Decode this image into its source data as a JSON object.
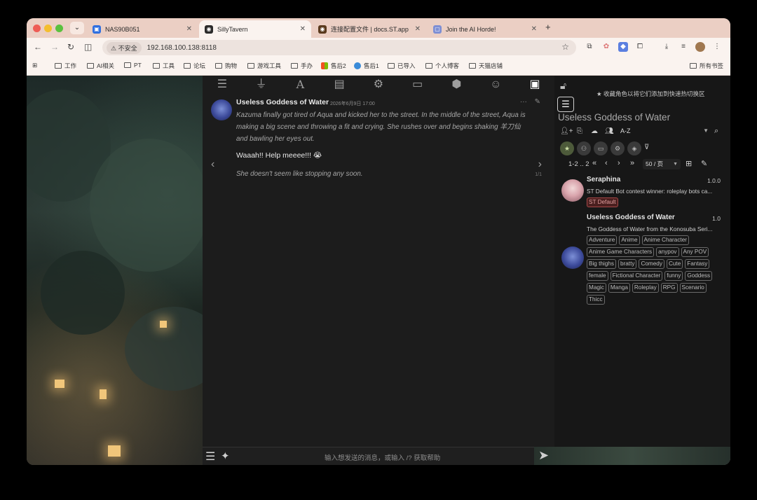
{
  "browser": {
    "tabs": [
      {
        "title": "NAS90B051",
        "active": false
      },
      {
        "title": "SillyTavern",
        "active": true
      },
      {
        "title": "连接配置文件 | docs.ST.app",
        "active": false
      },
      {
        "title": "Join the AI Horde!",
        "active": false
      }
    ],
    "insecure_label": "不安全",
    "url": "192.168.100.138:8118",
    "bookmarks": [
      "工作",
      "AI相关",
      "PT",
      "工具",
      "论坛",
      "购物",
      "游戏工具",
      "手办",
      "售后2",
      "售后1",
      "已导入",
      "个人博客",
      "天猫店铺"
    ],
    "all_bookmarks": "所有书签"
  },
  "chat": {
    "message": {
      "name": "Useless Goddess of Water",
      "time": "2026年6月9日 17:00",
      "narration": "Kazuma finally got tired of Aqua and kicked her to the street. In the middle of the street, Aqua is making a big scene and throwing a fit and crying. She rushes over and begins shaking 羊刀仙 and bawling her eyes out.",
      "speech": "Waaah!! Help meeee!!! 😭",
      "narration2": "She doesn't seem like stopping any soon.",
      "swipe_counter": "1/1"
    },
    "input_placeholder": "输入想发送的消息，或输入 /? 获取帮助"
  },
  "right_panel": {
    "favorite_hint": "收藏角色以将它们添加到快速热切换区",
    "selected_title": "Useless Goddess of Water",
    "sort_value": "A-Z",
    "pager_range": "1-2 .. 2",
    "per_page": "50 / 页",
    "characters": [
      {
        "name": "Seraphina",
        "version": "1.0.0",
        "description": "ST Default Bot contest winner: roleplay bots ca...",
        "tags": [
          "ST Default"
        ]
      },
      {
        "name": "Useless Goddess of Water",
        "version": "1.0",
        "description": "The Goddess of Water from the Konosuba Seri...",
        "tags": [
          "Adventure",
          "Anime",
          "Anime Character",
          "Anime Game Characters",
          "anypov",
          "Any POV",
          "Big thighs",
          "bratty",
          "Comedy",
          "Cute",
          "Fantasy",
          "female",
          "Fictional Character",
          "funny",
          "Goddess",
          "Magic",
          "Manga",
          "Roleplay",
          "RPG",
          "Scenario",
          "Thicc"
        ]
      }
    ]
  }
}
